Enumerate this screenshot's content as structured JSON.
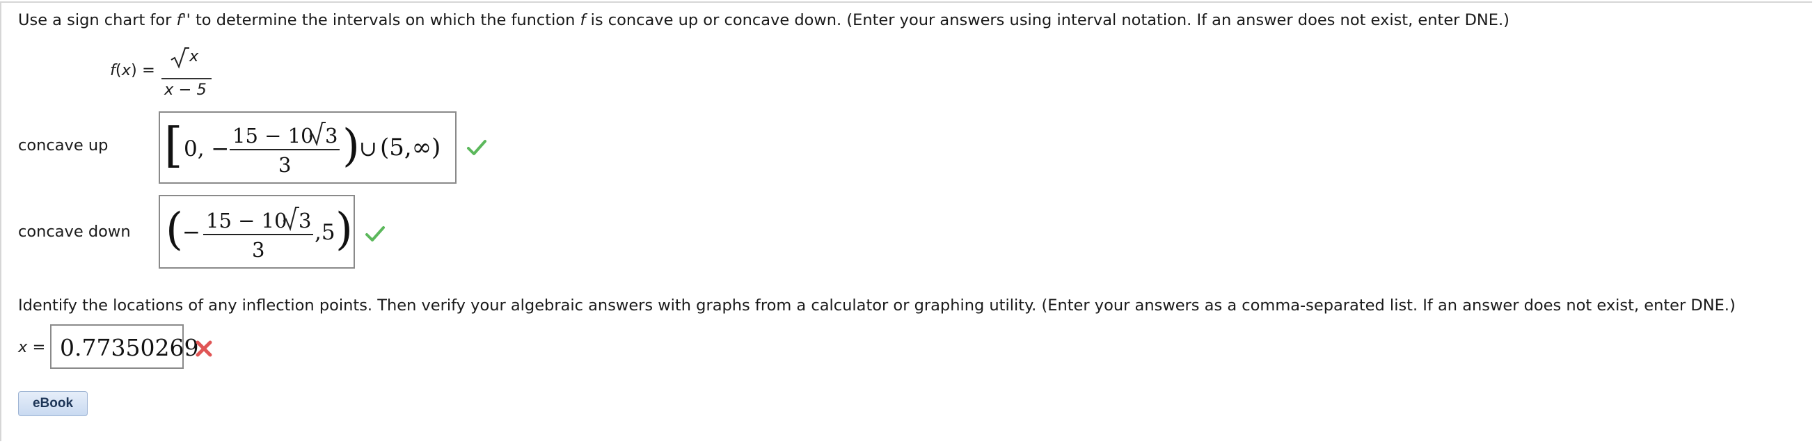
{
  "question": {
    "instruction_prefix": "Use a sign chart for ",
    "instruction_fpp": "f''",
    "instruction_middle": " to determine the intervals on which the function ",
    "instruction_f": "f",
    "instruction_suffix": " is concave up or concave down. (Enter your answers using interval notation. If an answer does not exist, enter DNE.)",
    "function_label": "f(x) =",
    "function_numerator": "x",
    "function_denominator": "x − 5"
  },
  "concave_up": {
    "label": "concave up",
    "answer": {
      "open": "[",
      "lead": "0, −",
      "numerator_left": "15 − 10",
      "numerator_radicand": "3",
      "denominator": "3",
      "close": ")",
      "union": "∪",
      "tail": "(5,∞)"
    },
    "status": "correct"
  },
  "concave_down": {
    "label": "concave down",
    "answer": {
      "open": "(",
      "lead": "−",
      "numerator_left": "15 − 10",
      "numerator_radicand": "3",
      "denominator": "3",
      "tail": ",5",
      "close": ")"
    },
    "status": "correct"
  },
  "inflection": {
    "instruction": "Identify the locations of any inflection points. Then verify your algebraic answers with graphs from a calculator or graphing utility. (Enter your answers as a comma-separated list. If an answer does not exist, enter DNE.)",
    "label": "x =",
    "answer": "0.77350269",
    "status": "incorrect"
  },
  "ebook_button": {
    "label": "eBook"
  },
  "colors": {
    "correct": "#5cb85c",
    "incorrect": "#e05555",
    "border": "#8a8a8a"
  }
}
